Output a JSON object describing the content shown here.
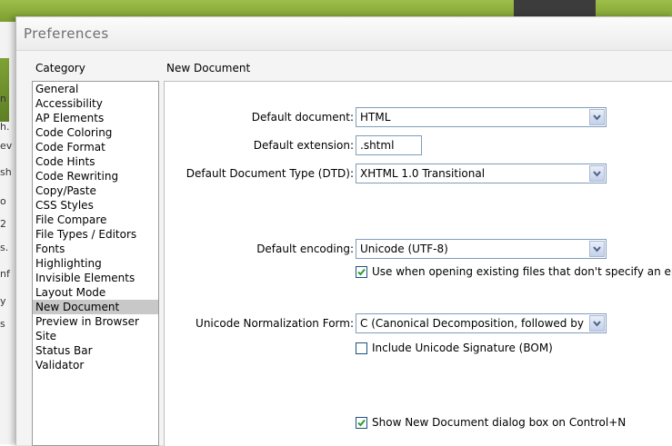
{
  "dialog": {
    "title": "Preferences",
    "category_header": "Category",
    "panel_header": "New Document"
  },
  "categories": [
    {
      "label": "General",
      "selected": false
    },
    {
      "label": "Accessibility",
      "selected": false
    },
    {
      "label": "AP Elements",
      "selected": false
    },
    {
      "label": "Code Coloring",
      "selected": false
    },
    {
      "label": "Code Format",
      "selected": false
    },
    {
      "label": "Code Hints",
      "selected": false
    },
    {
      "label": "Code Rewriting",
      "selected": false
    },
    {
      "label": "Copy/Paste",
      "selected": false
    },
    {
      "label": "CSS Styles",
      "selected": false
    },
    {
      "label": "File Compare",
      "selected": false
    },
    {
      "label": "File Types / Editors",
      "selected": false
    },
    {
      "label": "Fonts",
      "selected": false
    },
    {
      "label": "Highlighting",
      "selected": false
    },
    {
      "label": "Invisible Elements",
      "selected": false
    },
    {
      "label": "Layout Mode",
      "selected": false
    },
    {
      "label": "New Document",
      "selected": true
    },
    {
      "label": "Preview in Browser",
      "selected": false
    },
    {
      "label": "Site",
      "selected": false
    },
    {
      "label": "Status Bar",
      "selected": false
    },
    {
      "label": "Validator",
      "selected": false
    }
  ],
  "fields": {
    "default_document": {
      "label": "Default document:",
      "value": "HTML"
    },
    "default_extension": {
      "label": "Default extension:",
      "value": ".shtml"
    },
    "default_doctype": {
      "label": "Default Document Type (DTD):",
      "value": "XHTML 1.0 Transitional"
    },
    "default_encoding": {
      "label": "Default encoding:",
      "value": "Unicode (UTF-8)"
    },
    "use_when_opening": {
      "label": "Use when opening existing files that don't specify an er",
      "checked": true
    },
    "normalization_form": {
      "label": "Unicode Normalization Form:",
      "value": "C (Canonical Decomposition, followed by C"
    },
    "include_bom": {
      "label": "Include Unicode Signature (BOM)",
      "checked": false
    },
    "show_dialog": {
      "label": "Show New Document dialog box on Control+N",
      "checked": true
    }
  },
  "background_fragments": [
    "n",
    "h.",
    "ev",
    "sh",
    "o",
    "2",
    "s.",
    "nf",
    "y",
    "s"
  ],
  "colors": {
    "background_app_green": "#8aab3a",
    "select_border": "#7f9db9",
    "checkbox_check": "#2e9b2e",
    "selected_item": "#c8c8c8"
  }
}
